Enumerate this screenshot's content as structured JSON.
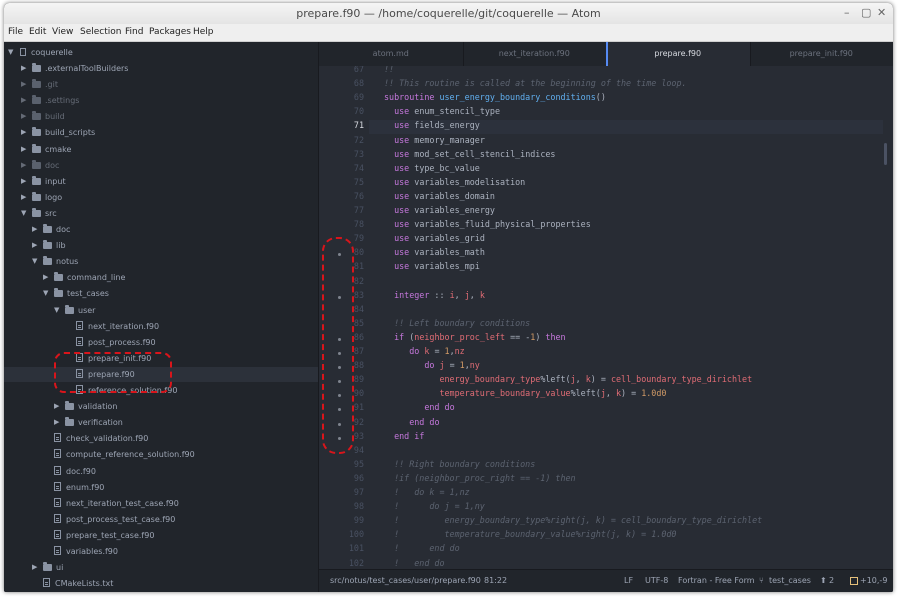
{
  "window": {
    "title": "prepare.f90 — /home/coquerelle/git/coquerelle — Atom",
    "controls": [
      "–",
      "▢",
      "✕"
    ]
  },
  "menu": [
    "File",
    "Edit",
    "View",
    "Selection",
    "Find",
    "Packages",
    "Help"
  ],
  "tree": {
    "root": "coquerelle",
    "items": [
      {
        "label": ".externalToolBuilders",
        "type": "folder",
        "open": false,
        "dim": false
      },
      {
        "label": ".git",
        "type": "folder",
        "open": false,
        "dim": true
      },
      {
        "label": ".settings",
        "type": "folder",
        "open": false,
        "dim": true
      },
      {
        "label": "build",
        "type": "folder",
        "open": false,
        "dim": true
      },
      {
        "label": "build_scripts",
        "type": "folder",
        "open": false,
        "dim": false
      },
      {
        "label": "cmake",
        "type": "folder",
        "open": false,
        "dim": false
      },
      {
        "label": "doc",
        "type": "folder",
        "open": false,
        "dim": true
      },
      {
        "label": "input",
        "type": "folder",
        "open": false,
        "dim": false
      },
      {
        "label": "logo",
        "type": "folder",
        "open": false,
        "dim": false
      },
      {
        "label": "src",
        "type": "folder",
        "open": true,
        "dim": false
      },
      {
        "label": "doc",
        "type": "folder",
        "open": false,
        "dim": false
      },
      {
        "label": "lib",
        "type": "folder",
        "open": false,
        "dim": false
      },
      {
        "label": "notus",
        "type": "folder",
        "open": true,
        "dim": false
      },
      {
        "label": "command_line",
        "type": "folder",
        "open": false,
        "dim": false
      },
      {
        "label": "test_cases",
        "type": "folder",
        "open": true,
        "dim": false
      },
      {
        "label": "user",
        "type": "folder",
        "open": true,
        "dim": false
      },
      {
        "label": "next_iteration.f90",
        "type": "file",
        "dim": false
      },
      {
        "label": "post_process.f90",
        "type": "file",
        "dim": false
      },
      {
        "label": "prepare_init.f90",
        "type": "file",
        "dim": false
      },
      {
        "label": "prepare.f90",
        "type": "file",
        "dim": false
      },
      {
        "label": "reference_solution.f90",
        "type": "file",
        "dim": false
      },
      {
        "label": "validation",
        "type": "folder",
        "open": false,
        "dim": false
      },
      {
        "label": "verification",
        "type": "folder",
        "open": false,
        "dim": false
      },
      {
        "label": "check_validation.f90",
        "type": "file",
        "dim": false
      },
      {
        "label": "compute_reference_solution.f90",
        "type": "file",
        "dim": false
      },
      {
        "label": "doc.f90",
        "type": "file",
        "dim": false
      },
      {
        "label": "enum.f90",
        "type": "file",
        "dim": false
      },
      {
        "label": "next_iteration_test_case.f90",
        "type": "file",
        "dim": false
      },
      {
        "label": "post_process_test_case.f90",
        "type": "file",
        "dim": false
      },
      {
        "label": "prepare_test_case.f90",
        "type": "file",
        "dim": false
      },
      {
        "label": "variables.f90",
        "type": "file",
        "dim": false
      },
      {
        "label": "ui",
        "type": "folder",
        "open": false,
        "dim": false
      },
      {
        "label": "CMakeLists.txt",
        "type": "file",
        "dim": false
      }
    ]
  },
  "tabs": [
    "atom.md",
    "next_iteration.f90",
    "prepare.f90",
    "prepare_init.f90"
  ],
  "active_tab": "prepare.f90",
  "code": {
    "current_line": "71",
    "lines": [
      {
        "n": "67",
        "t": "!!"
      },
      {
        "n": "68",
        "t": "!! This routine is called at the beginning of the time loop."
      },
      {
        "n": "69",
        "t": "subroutine user_energy_boundary_conditions()"
      },
      {
        "n": "70",
        "t": "  use enum_stencil_type"
      },
      {
        "n": "71",
        "t": "  use fields_energy"
      },
      {
        "n": "72",
        "t": "  use memory_manager"
      },
      {
        "n": "73",
        "t": "  use mod_set_cell_stencil_indices"
      },
      {
        "n": "74",
        "t": "  use type_bc_value"
      },
      {
        "n": "75",
        "t": "  use variables_modelisation"
      },
      {
        "n": "76",
        "t": "  use variables_domain"
      },
      {
        "n": "77",
        "t": "  use variables_energy"
      },
      {
        "n": "78",
        "t": "  use variables_fluid_physical_properties"
      },
      {
        "n": "79",
        "t": "  use variables_grid"
      },
      {
        "n": "80",
        "t": "  use variables_math"
      },
      {
        "n": "81",
        "t": "  use variables_mpi"
      },
      {
        "n": "82",
        "t": ""
      },
      {
        "n": "83",
        "t": "  integer :: i, j, k"
      },
      {
        "n": "84",
        "t": ""
      },
      {
        "n": "85",
        "t": "  !! Left boundary conditions"
      },
      {
        "n": "86",
        "t": "  if (neighbor_proc_left == -1) then"
      },
      {
        "n": "87",
        "t": "     do k = 1,nz"
      },
      {
        "n": "88",
        "t": "        do j = 1,ny"
      },
      {
        "n": "89",
        "t": "           energy_boundary_type%left(j, k) = cell_boundary_type_dirichlet"
      },
      {
        "n": "90",
        "t": "           temperature_boundary_value%left(j, k) = 1.0d0"
      },
      {
        "n": "91",
        "t": "        end do"
      },
      {
        "n": "92",
        "t": "     end do"
      },
      {
        "n": "93",
        "t": "  end if"
      },
      {
        "n": "94",
        "t": ""
      },
      {
        "n": "95",
        "t": "  !! Right boundary conditions"
      },
      {
        "n": "96",
        "t": "  !if (neighbor_proc_right == -1) then"
      },
      {
        "n": "97",
        "t": "  !   do k = 1,nz"
      },
      {
        "n": "98",
        "t": "  !      do j = 1,ny"
      },
      {
        "n": "99",
        "t": "  !         energy_boundary_type%right(j, k) = cell_boundary_type_dirichlet"
      },
      {
        "n": "100",
        "t": "  !         temperature_boundary_value%right(j, k) = 1.0d0"
      },
      {
        "n": "101",
        "t": "  !      end do"
      },
      {
        "n": "102",
        "t": "  !   end do"
      }
    ]
  },
  "status": {
    "path": "src/notus/test_cases/user/prepare.f90",
    "cursor": "81:22",
    "eol": "LF",
    "encoding": "UTF-8",
    "grammar": "Fortran - Free Form",
    "branch": "test_cases",
    "push": "2",
    "diff": "+10,-9"
  },
  "colors": {
    "annotation": "#d9151b",
    "accent": "#568af2",
    "background": "#282c34"
  }
}
